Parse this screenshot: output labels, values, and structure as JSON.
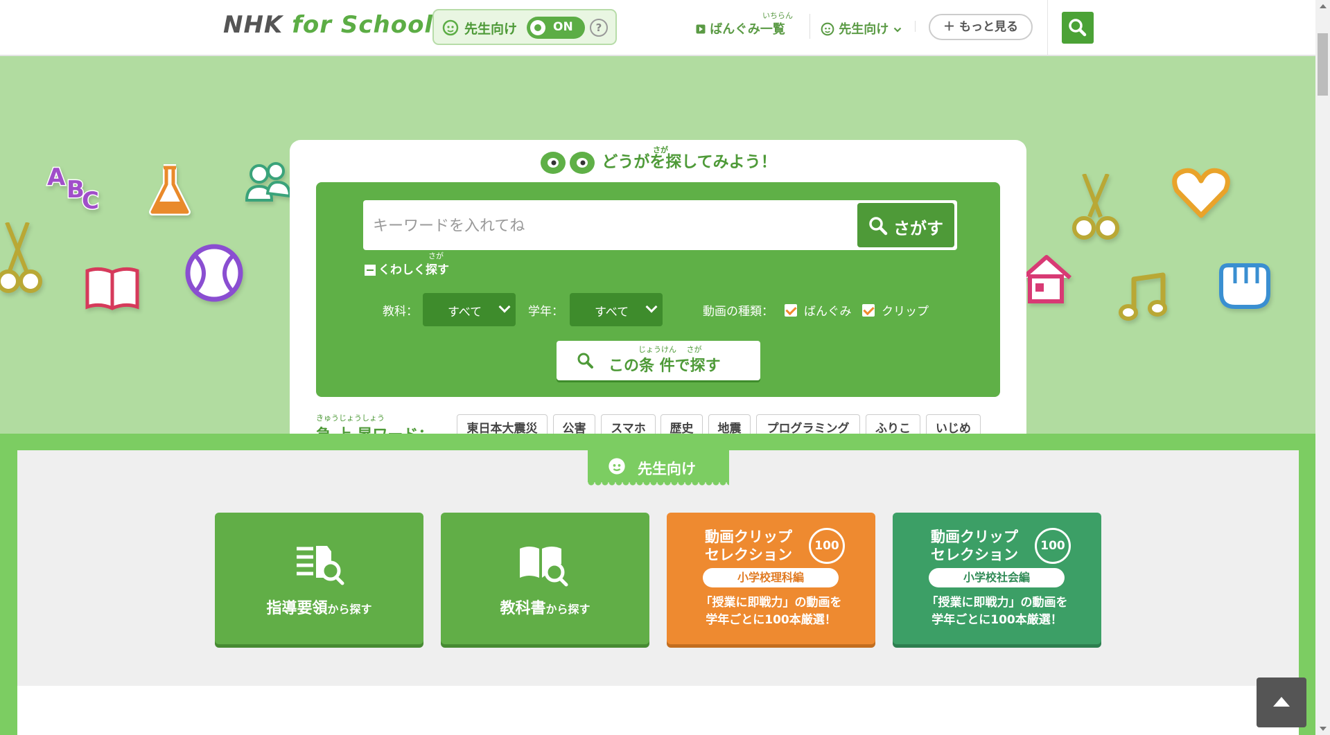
{
  "header": {
    "logo_nhk": "NHK",
    "logo_rest": "for School",
    "teacher_mode_label": "先生向け",
    "teacher_mode_state": "ON",
    "help_label": "?",
    "nav_programs_label": "ばんぐみ一覧",
    "nav_programs_ruby": "いちらん",
    "nav_teacher_label": "先生向け",
    "more_label": "＋ もっと見る"
  },
  "hero": {
    "title": "どうがを探してみよう！",
    "title_ruby": "さが",
    "search": {
      "placeholder": "キーワードを入れてね",
      "button_label": "さがす"
    },
    "detail_label": "くわしく探す",
    "detail_ruby": "さが",
    "filters": {
      "subject_label": "教科：",
      "subject_value": "すべて",
      "grade_label": "学年：",
      "grade_value": "すべて",
      "type_label": "動画の種類：",
      "type_options": [
        {
          "label": "ばんぐみ",
          "checked": true
        },
        {
          "label": "クリップ",
          "checked": true
        }
      ]
    },
    "condition_button_label": "この条 件で探す",
    "condition_button_ruby": "じょうけん　 さが",
    "trending": {
      "label": "急 上 昇ワード：",
      "ruby": "きゅうじょうしょう",
      "tags": [
        "東日本大震災",
        "公害",
        "スマホ",
        "歴史",
        "地震",
        "プログラミング",
        "ふりこ",
        "いじめ"
      ]
    },
    "decor_icons": [
      "abc-icon",
      "flask-icon",
      "people-icon",
      "scissors-icon",
      "book-icon",
      "ball-icon",
      "house-icon",
      "music-note-icon",
      "heart-icon",
      "fist-icon"
    ]
  },
  "teacher": {
    "tab_label": "先生向け",
    "cards": [
      {
        "big": "指導要領",
        "small": "から探す"
      },
      {
        "big": "教科書",
        "small": "から探す"
      },
      {
        "heading_1": "動画クリップ",
        "heading_2": "セレクション",
        "badge": "100",
        "pill": "小学校理科編",
        "desc_1": "「授業に即戦力」の動画を",
        "desc_2": "学年ごとに100本厳選！"
      },
      {
        "heading_1": "動画クリップ",
        "heading_2": "セレクション",
        "badge": "100",
        "pill": "小学校社会編",
        "desc_1": "「授業に即戦力」の動画を",
        "desc_2": "学年ごとに100本厳選！"
      }
    ]
  },
  "colors": {
    "brand_green": "#5fb047",
    "hero_bg": "#b1dca0",
    "orange": "#ee8a30",
    "teal": "#3c9f66"
  }
}
